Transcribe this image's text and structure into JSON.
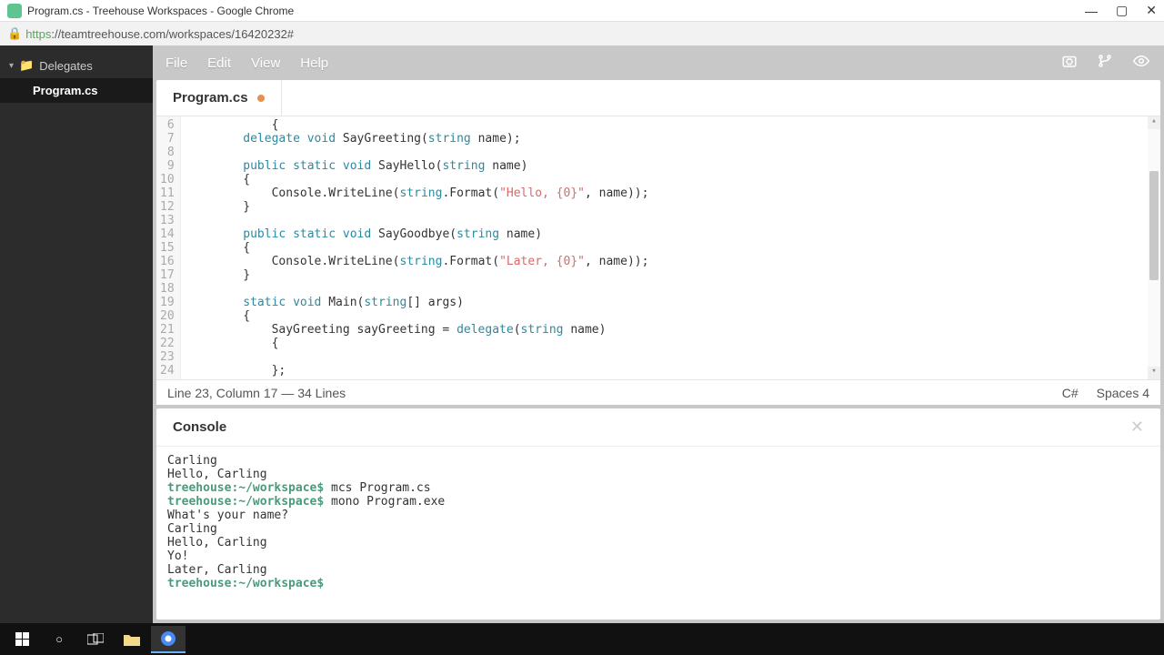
{
  "window": {
    "title": "Program.cs - Treehouse Workspaces - Google Chrome"
  },
  "url": {
    "protocol": "https",
    "rest": "://teamtreehouse.com/workspaces/16420232#"
  },
  "sidebar": {
    "root": "Delegates",
    "file": "Program.cs"
  },
  "menu": {
    "file": "File",
    "edit": "Edit",
    "view": "View",
    "help": "Help"
  },
  "tab": {
    "label": "Program.cs"
  },
  "code": {
    "lines": [
      {
        "n": 6,
        "html": "            {"
      },
      {
        "n": 7,
        "html": "        <span class='kw'>delegate</span> <span class='kw'>void</span> SayGreeting(<span class='kw'>string</span> name);"
      },
      {
        "n": 8,
        "html": ""
      },
      {
        "n": 9,
        "html": "        <span class='kw'>public</span> <span class='kw'>static</span> <span class='kw'>void</span> SayHello(<span class='kw'>string</span> name)"
      },
      {
        "n": 10,
        "html": "        {"
      },
      {
        "n": 11,
        "html": "            Console.WriteLine(<span class='kw'>string</span>.Format(<span class='str'>\"Hello, {0}\"</span>, name));"
      },
      {
        "n": 12,
        "html": "        }"
      },
      {
        "n": 13,
        "html": ""
      },
      {
        "n": 14,
        "html": "        <span class='kw'>public</span> <span class='kw'>static</span> <span class='kw'>void</span> SayGoodbye(<span class='kw'>string</span> name)"
      },
      {
        "n": 15,
        "html": "        {"
      },
      {
        "n": 16,
        "html": "            Console.WriteLine(<span class='kw'>string</span>.Format(<span class='str'>\"Later, {0}\"</span>, name));"
      },
      {
        "n": 17,
        "html": "        }"
      },
      {
        "n": 18,
        "html": ""
      },
      {
        "n": 19,
        "html": "        <span class='kw'>static</span> <span class='kw'>void</span> Main(<span class='kw'>string</span>[] args)"
      },
      {
        "n": 20,
        "html": "        {"
      },
      {
        "n": 21,
        "html": "            SayGreeting sayGreeting = <span class='kw'>delegate</span>(<span class='kw'>string</span> name)"
      },
      {
        "n": 22,
        "html": "            {"
      },
      {
        "n": 23,
        "html": ""
      },
      {
        "n": 24,
        "html": "            };"
      }
    ]
  },
  "status": {
    "left": "Line 23, Column 17 — 34 Lines",
    "lang": "C#",
    "spaces": "Spaces 4"
  },
  "console": {
    "title": "Console",
    "lines": [
      {
        "html": "Carling"
      },
      {
        "html": "Hello, Carling"
      },
      {
        "html": "<span class='prompt'>treehouse:~/workspace$</span> mcs Program.cs"
      },
      {
        "html": "<span class='prompt'>treehouse:~/workspace$</span> mono Program.exe"
      },
      {
        "html": "What's your name?"
      },
      {
        "html": "Carling"
      },
      {
        "html": "Hello, Carling"
      },
      {
        "html": "Yo!"
      },
      {
        "html": "Later, Carling"
      },
      {
        "html": "<span class='prompt'>treehouse:~/workspace$</span>"
      }
    ]
  }
}
